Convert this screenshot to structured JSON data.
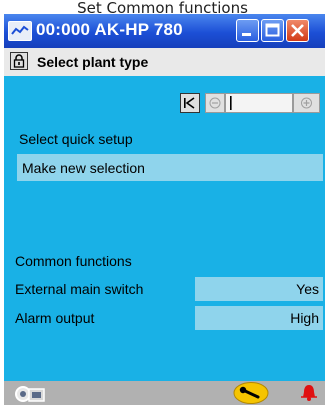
{
  "top_caption": "Set Common functions",
  "window": {
    "title": "00:000 AK-HP 780"
  },
  "header": {
    "title": "Select plant type"
  },
  "quick_setup": {
    "label": "Select quick setup",
    "selection": "Make new selection"
  },
  "common_functions": {
    "heading": "Common functions",
    "rows": [
      {
        "label": "External main switch",
        "value": "Yes"
      },
      {
        "label": "Alarm output",
        "value": "High"
      }
    ]
  },
  "colors": {
    "content_bg": "#19b1e6",
    "row_highlight": "#8fd4ec",
    "titlebar": "#1c4fd6",
    "statusbar": "#b1b1b1"
  },
  "icons": {
    "title": "app-icon",
    "lock": "lock-icon",
    "first": "first-page-icon",
    "prev": "previous-icon",
    "next": "next-icon",
    "status_left": "device-icon",
    "status_key": "wrench-icon",
    "status_alarm": "alarm-bell-icon"
  }
}
